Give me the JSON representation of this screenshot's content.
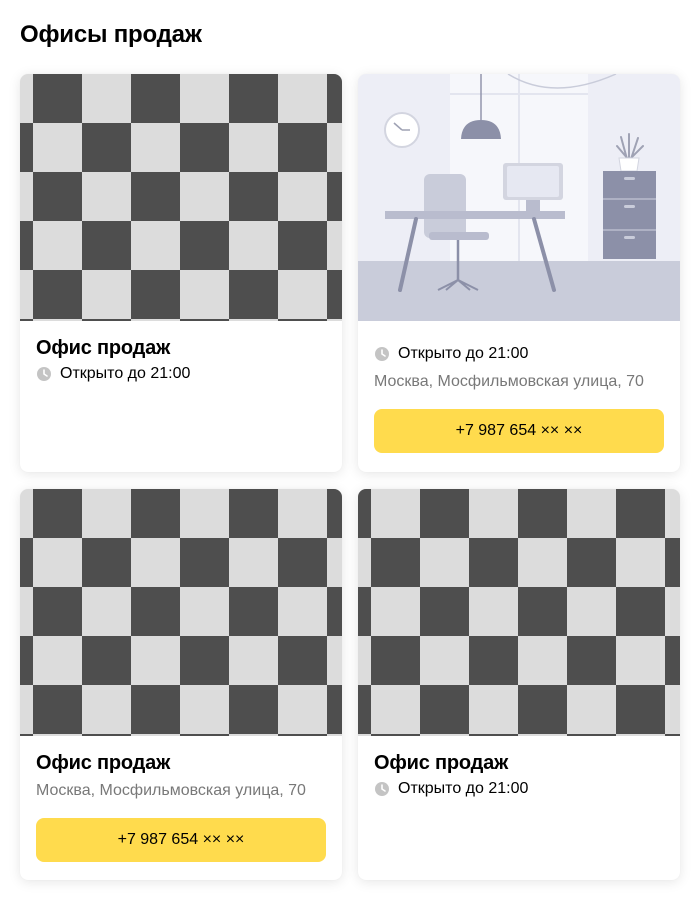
{
  "page": {
    "title": "Офисы продаж"
  },
  "colors": {
    "accent": "#ffdb4d",
    "secondary_text": "#787878",
    "checker_dark": "#4e4e4e",
    "checker_light": "#dcdcdc"
  },
  "cards": [
    {
      "image": "placeholder-checkerboard",
      "title": "Офис продаж",
      "hours": "Открыто до 21:00",
      "icon": "clock-icon"
    },
    {
      "image": "office-illustration",
      "hours": "Открыто до 21:00",
      "address": "Москва, Мосфильмовская улица, 70",
      "phone": "+7 987 654 ×× ××",
      "icon": "clock-icon"
    },
    {
      "image": "placeholder-checkerboard",
      "title": "Офис продаж",
      "address": "Москва, Мосфильмовская улица, 70",
      "phone": "+7 987 654 ×× ××"
    },
    {
      "image": "placeholder-checkerboard",
      "title": "Офис продаж",
      "hours": "Открыто до 21:00",
      "icon": "clock-icon"
    }
  ]
}
